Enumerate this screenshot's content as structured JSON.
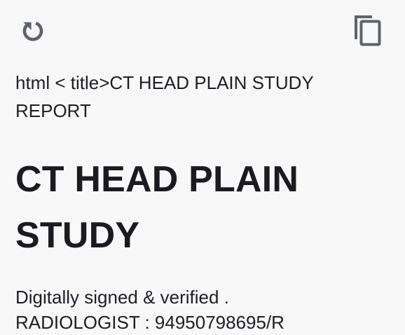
{
  "toolbar": {
    "reload_icon": "reload-icon",
    "copy_icon": "copy-icon"
  },
  "document": {
    "raw_title": "html < title>CT HEAD PLAIN STUDY REPORT",
    "heading": "CT HEAD PLAIN STUDY",
    "signed_line": "Digitally signed & verified .",
    "cutoff_line": "RADIOLOGIST : 94950798695/R"
  },
  "colors": {
    "background": "#f8f8f9",
    "text": "#1d1d21",
    "icon": "#5f6368"
  }
}
